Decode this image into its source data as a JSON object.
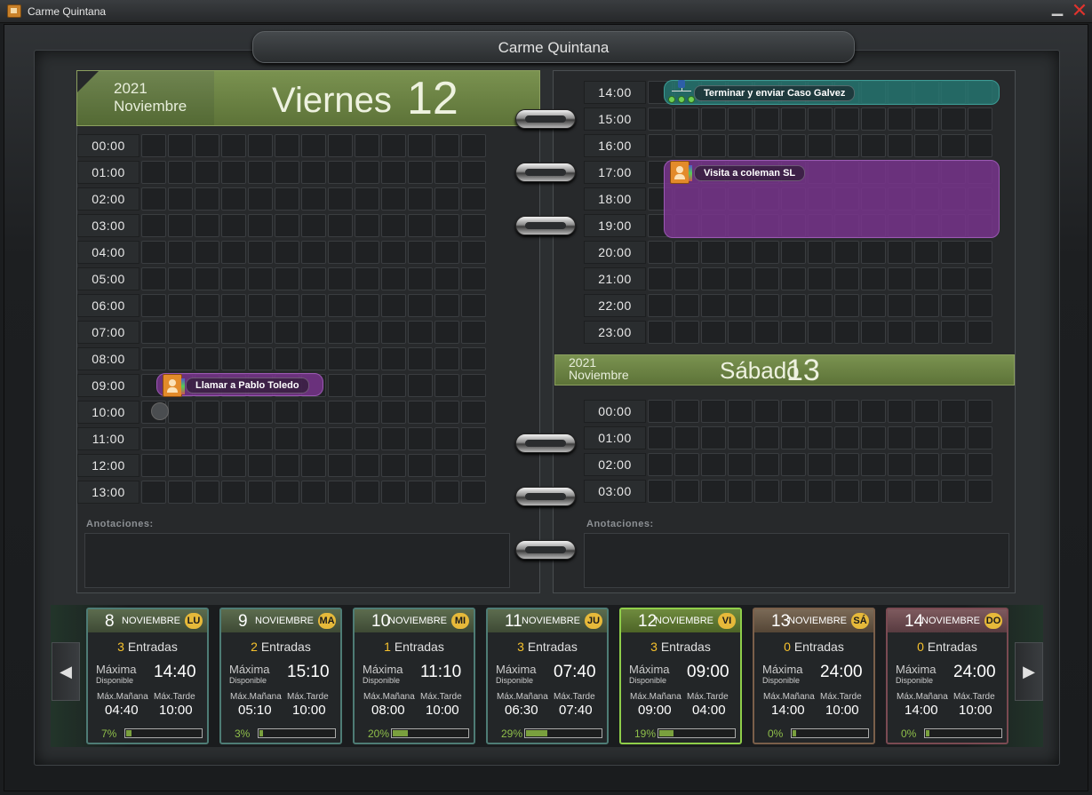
{
  "window": {
    "title": "Carme Quintana"
  },
  "agenda": {
    "title": "Carme Quintana"
  },
  "day1": {
    "year": "2021",
    "month": "Noviembre",
    "weekday": "Viernes",
    "day": "12"
  },
  "day2": {
    "year": "2021",
    "month": "Noviembre",
    "weekday": "Sábado",
    "day": "13"
  },
  "left_hours": [
    "00:00",
    "01:00",
    "02:00",
    "03:00",
    "04:00",
    "05:00",
    "06:00",
    "07:00",
    "08:00",
    "09:00",
    "10:00",
    "11:00",
    "12:00",
    "13:00"
  ],
  "right_hours_day1": [
    "14:00",
    "15:00",
    "16:00",
    "17:00",
    "18:00",
    "19:00",
    "20:00",
    "21:00",
    "22:00",
    "23:00"
  ],
  "right_hours_day2": [
    "00:00",
    "01:00",
    "02:00",
    "03:00"
  ],
  "events": {
    "ev1": {
      "title": "Llamar a Pablo Toledo",
      "icon": "contact-book-icon"
    },
    "ev2": {
      "title": "Terminar y enviar  Caso Galvez",
      "icon": "org-chart-icon"
    },
    "ev3": {
      "title": "Visita a coleman SL",
      "icon": "contact-book-icon"
    }
  },
  "annotations": {
    "left_label": "Anotaciones:",
    "right_label": "Anotaciones:"
  },
  "labels": {
    "entradas": "Entradas",
    "maxima": "Máxima",
    "disponible": "Disponible",
    "max_manana": "Máx.Mañana",
    "max_tarde": "Máx.Tarde"
  },
  "days": [
    {
      "num": "8",
      "month": "NOVIEMBRE",
      "abbr": "LU",
      "entries": "3",
      "max": "14:40",
      "manana": "04:40",
      "tarde": "10:00",
      "pct": "7%",
      "fill": 0.07
    },
    {
      "num": "9",
      "month": "NOVIEMBRE",
      "abbr": "MA",
      "entries": "2",
      "max": "15:10",
      "manana": "05:10",
      "tarde": "10:00",
      "pct": "3%",
      "fill": 0.03
    },
    {
      "num": "10",
      "month": "NOVIEMBRE",
      "abbr": "MI",
      "entries": "1",
      "max": "11:10",
      "manana": "08:00",
      "tarde": "10:00",
      "pct": "20%",
      "fill": 0.2
    },
    {
      "num": "11",
      "month": "NOVIEMBRE",
      "abbr": "JU",
      "entries": "3",
      "max": "07:40",
      "manana": "06:30",
      "tarde": "07:40",
      "pct": "29%",
      "fill": 0.29
    },
    {
      "num": "12",
      "month": "NOVIEMBRE",
      "abbr": "VI",
      "entries": "3",
      "max": "09:00",
      "manana": "09:00",
      "tarde": "04:00",
      "pct": "19%",
      "fill": 0.19
    },
    {
      "num": "13",
      "month": "NOVIEMBRE",
      "abbr": "SÁ",
      "entries": "0",
      "max": "24:00",
      "manana": "14:00",
      "tarde": "10:00",
      "pct": "0%",
      "fill": 0
    },
    {
      "num": "14",
      "month": "NOVIEMBRE",
      "abbr": "DO",
      "entries": "0",
      "max": "24:00",
      "manana": "14:00",
      "tarde": "10:00",
      "pct": "0%",
      "fill": 0
    }
  ],
  "nav": {
    "prev_icon": "chevron-left-icon",
    "next_icon": "chevron-right-icon"
  },
  "colors": {
    "accent_green": "#7a9250",
    "event_blue": "#26787",
    "event_purple": "#78348c",
    "count_yellow": "#f6c12d"
  }
}
